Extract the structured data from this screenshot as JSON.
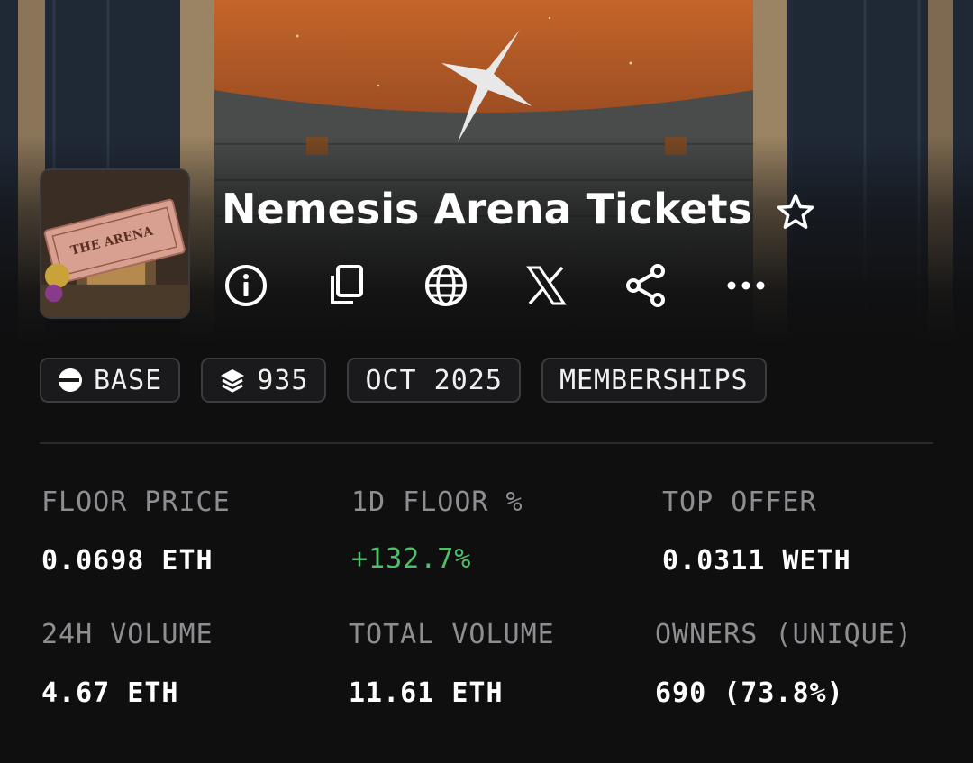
{
  "collection": {
    "name": "Nemesis Arena Tickets",
    "avatar_ticket_text": "THE ARENA"
  },
  "actions": [
    {
      "name": "info-icon"
    },
    {
      "name": "copy-icon"
    },
    {
      "name": "globe-icon"
    },
    {
      "name": "x-logo-icon"
    },
    {
      "name": "share-icon"
    },
    {
      "name": "more-icon"
    }
  ],
  "tags": {
    "chain": "BASE",
    "items": "935",
    "date": "OCT 2025",
    "category": "MEMBERSHIPS"
  },
  "stats": {
    "floor_price_label": "FLOOR PRICE",
    "floor_price_value": "0.0698 ETH",
    "floor_change_label": "1D FLOOR %",
    "floor_change_value": "+132.7%",
    "top_offer_label": "TOP OFFER",
    "top_offer_value": "0.0311 WETH",
    "volume_24h_label": "24H VOLUME",
    "volume_24h_value": "4.67 ETH",
    "total_volume_label": "TOTAL VOLUME",
    "total_volume_value": "11.61 ETH",
    "owners_label": "OWNERS (UNIQUE)",
    "owners_value": "690 (73.8%)"
  },
  "colors": {
    "background": "#0f0f10",
    "positive": "#4fbf6a",
    "label": "#8e8e92",
    "sky": "#b8602a"
  }
}
